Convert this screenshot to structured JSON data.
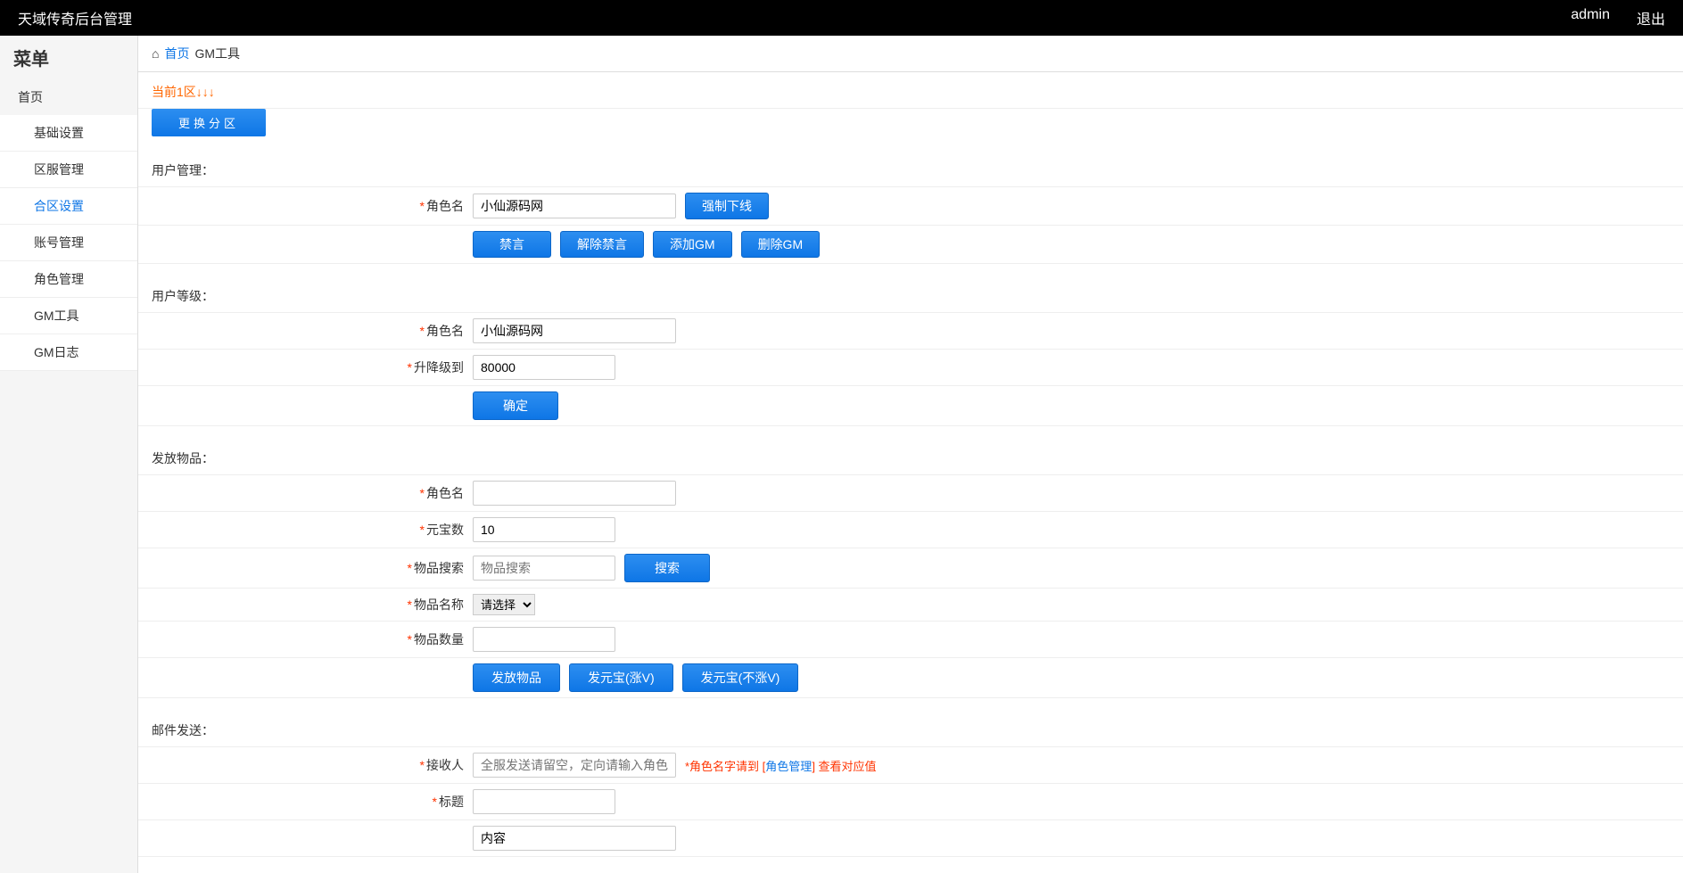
{
  "header": {
    "title": "天域传奇后台管理",
    "user": "admin",
    "logout": "退出"
  },
  "sidebar": {
    "title": "菜单",
    "home": "首页",
    "items": [
      {
        "label": "基础设置",
        "active": false
      },
      {
        "label": "区服管理",
        "active": false
      },
      {
        "label": "合区设置",
        "active": true
      },
      {
        "label": "账号管理",
        "active": false
      },
      {
        "label": "角色管理",
        "active": false
      },
      {
        "label": "GM工具",
        "active": false
      },
      {
        "label": "GM日志",
        "active": false
      }
    ]
  },
  "breadcrumb": {
    "home": "首页",
    "current": "GM工具"
  },
  "zone": {
    "current": "当前1区↓↓↓",
    "change_btn": "更换分区"
  },
  "user_manage": {
    "title": "用户管理：",
    "role_label": "角色名",
    "role_value": "小仙源码网",
    "force_offline": "强制下线",
    "mute": "禁言",
    "unmute": "解除禁言",
    "add_gm": "添加GM",
    "remove_gm": "删除GM"
  },
  "user_level": {
    "title": "用户等级：",
    "role_label": "角色名",
    "role_value": "小仙源码网",
    "level_label": "升降级到",
    "level_value": "80000",
    "confirm": "确定"
  },
  "give_item": {
    "title": "发放物品：",
    "role_label": "角色名",
    "role_value": "",
    "yuanbao_label": "元宝数",
    "yuanbao_value": "10",
    "search_label": "物品搜索",
    "search_placeholder": "物品搜索",
    "search_btn": "搜索",
    "item_name_label": "物品名称",
    "item_name_select": "请选择",
    "item_count_label": "物品数量",
    "item_count_value": "",
    "give_item_btn": "发放物品",
    "give_yb_vip_btn": "发元宝(涨V)",
    "give_yb_novip_btn": "发元宝(不涨V)"
  },
  "mail": {
    "title": "邮件发送：",
    "recipient_label": "接收人",
    "recipient_placeholder": "全服发送请留空，定向请输入角色名字",
    "hint_prefix": "*角色名字请到 [",
    "hint_link": "角色管理",
    "hint_suffix": "] 查看对应值",
    "subject_label": "标题",
    "subject_value": "",
    "content_value": "内容"
  }
}
